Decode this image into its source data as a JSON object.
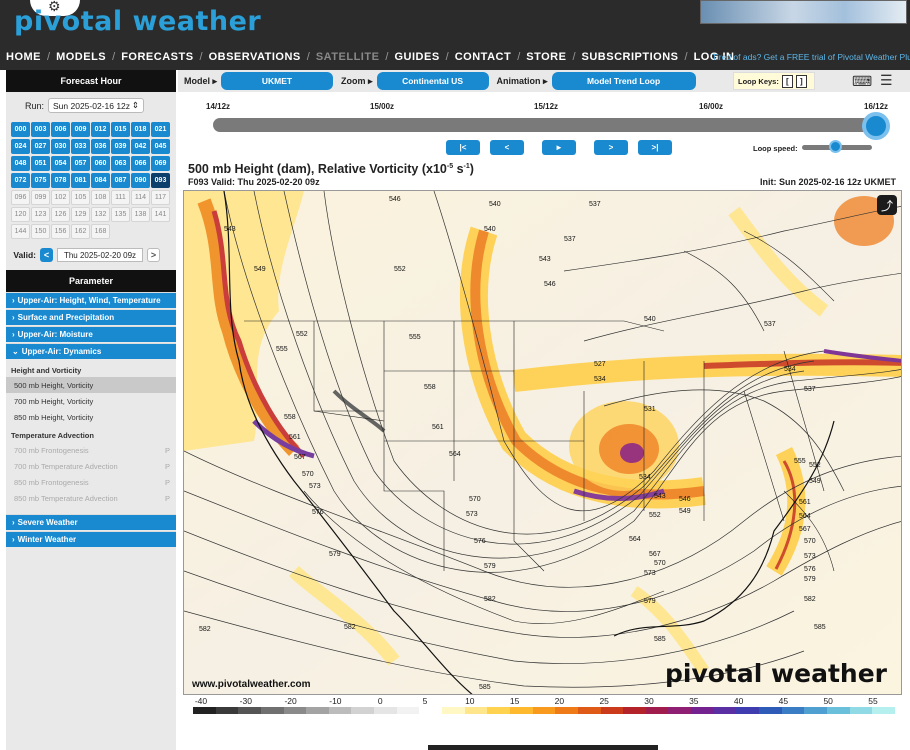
{
  "header": {
    "logo": "pivotal weather",
    "nav": [
      {
        "label": "HOME",
        "dim": false
      },
      {
        "label": "MODELS",
        "dim": false
      },
      {
        "label": "FORECASTS",
        "dim": false
      },
      {
        "label": "OBSERVATIONS",
        "dim": false
      },
      {
        "label": "SATELLITE",
        "dim": true
      },
      {
        "label": "GUIDES",
        "dim": false
      },
      {
        "label": "CONTACT",
        "dim": false
      },
      {
        "label": "STORE",
        "dim": false
      },
      {
        "label": "SUBSCRIPTIONS",
        "dim": false
      },
      {
        "label": "LOG IN",
        "dim": false
      }
    ],
    "promo": "Tired of ads? Get a FREE trial of Pivotal Weather Plus!"
  },
  "sidebar": {
    "forecast_hour_title": "Forecast Hour",
    "run_label": "Run:",
    "run_value": "Sun 2025-02-16 12z",
    "hours": [
      {
        "h": "000",
        "s": "on"
      },
      {
        "h": "003",
        "s": "on"
      },
      {
        "h": "006",
        "s": "on"
      },
      {
        "h": "009",
        "s": "on"
      },
      {
        "h": "012",
        "s": "on"
      },
      {
        "h": "015",
        "s": "on"
      },
      {
        "h": "018",
        "s": "on"
      },
      {
        "h": "021",
        "s": "on"
      },
      {
        "h": "024",
        "s": "on"
      },
      {
        "h": "027",
        "s": "on"
      },
      {
        "h": "030",
        "s": "on"
      },
      {
        "h": "033",
        "s": "on"
      },
      {
        "h": "036",
        "s": "on"
      },
      {
        "h": "039",
        "s": "on"
      },
      {
        "h": "042",
        "s": "on"
      },
      {
        "h": "045",
        "s": "on"
      },
      {
        "h": "048",
        "s": "on"
      },
      {
        "h": "051",
        "s": "on"
      },
      {
        "h": "054",
        "s": "on"
      },
      {
        "h": "057",
        "s": "on"
      },
      {
        "h": "060",
        "s": "on"
      },
      {
        "h": "063",
        "s": "on"
      },
      {
        "h": "066",
        "s": "on"
      },
      {
        "h": "069",
        "s": "on"
      },
      {
        "h": "072",
        "s": "on"
      },
      {
        "h": "075",
        "s": "on"
      },
      {
        "h": "078",
        "s": "on"
      },
      {
        "h": "081",
        "s": "on"
      },
      {
        "h": "084",
        "s": "on"
      },
      {
        "h": "087",
        "s": "on"
      },
      {
        "h": "090",
        "s": "on"
      },
      {
        "h": "093",
        "s": "sel"
      },
      {
        "h": "096",
        "s": "off"
      },
      {
        "h": "099",
        "s": "off"
      },
      {
        "h": "102",
        "s": "off"
      },
      {
        "h": "105",
        "s": "off"
      },
      {
        "h": "108",
        "s": "off"
      },
      {
        "h": "111",
        "s": "off"
      },
      {
        "h": "114",
        "s": "off"
      },
      {
        "h": "117",
        "s": "off"
      },
      {
        "h": "120",
        "s": "off"
      },
      {
        "h": "123",
        "s": "off"
      },
      {
        "h": "126",
        "s": "off"
      },
      {
        "h": "129",
        "s": "off"
      },
      {
        "h": "132",
        "s": "off"
      },
      {
        "h": "135",
        "s": "off"
      },
      {
        "h": "138",
        "s": "off"
      },
      {
        "h": "141",
        "s": "off"
      },
      {
        "h": "144",
        "s": "off"
      },
      {
        "h": "150",
        "s": "off"
      },
      {
        "h": "156",
        "s": "off"
      },
      {
        "h": "162",
        "s": "off"
      },
      {
        "h": "168",
        "s": "off"
      }
    ],
    "valid_label": "Valid:",
    "valid_value": "Thu 2025-02-20 09z",
    "prev": "<",
    "next": ">",
    "parameter_title": "Parameter",
    "categories_top": [
      "Upper-Air: Height, Wind, Temperature",
      "Surface and Precipitation",
      "Upper-Air: Moisture",
      "Upper-Air: Dynamics"
    ],
    "group1": "Height and Vorticity",
    "group1_items": [
      {
        "label": "500 mb Height, Vorticity",
        "state": "sel",
        "p": ""
      },
      {
        "label": "700 mb Height, Vorticity",
        "state": "on",
        "p": ""
      },
      {
        "label": "850 mb Height, Vorticity",
        "state": "on",
        "p": ""
      }
    ],
    "group2": "Temperature Advection",
    "group2_items": [
      {
        "label": "700 mb Frontogenesis",
        "state": "off",
        "p": "P"
      },
      {
        "label": "700 mb Temperature Advection",
        "state": "off",
        "p": "P"
      },
      {
        "label": "850 mb Frontogenesis",
        "state": "off",
        "p": "P"
      },
      {
        "label": "850 mb Temperature Advection",
        "state": "off",
        "p": "P"
      }
    ],
    "categories_bottom": [
      "Severe Weather",
      "Winter Weather"
    ]
  },
  "toolbar": {
    "model_label": "Model ▸",
    "model_value": "UKMET",
    "zoom_label": "Zoom ▸",
    "zoom_value": "Continental US",
    "anim_label": "Animation ▸",
    "anim_value": "Model Trend Loop",
    "loop_keys": "Loop Keys:",
    "key1": "[",
    "key2": "]",
    "kbd_icon": "⌨",
    "settings_icon": "☰"
  },
  "timeline": {
    "ticks": [
      "14/12z",
      "15/00z",
      "15/12z",
      "16/00z",
      "16/12z"
    ],
    "buttons": [
      "|<",
      "<",
      "►",
      ">",
      ">|"
    ],
    "loop_speed": "Loop speed:",
    "title_main": "500 mb Height (dam), Relative Vorticity (x10",
    "title_exp": "-5",
    "title_unit": " s",
    "title_exp2": "-1",
    "title_close": ")",
    "valid": "F093 Valid: Thu 2025-02-20 09z",
    "init": "Init: Sun 2025-02-16 12z UKMET"
  },
  "map": {
    "url": "www.pivotalweather.com",
    "watermark": "pivotal weather",
    "share_icon": "⤴",
    "contour_labels": [
      {
        "t": "543"
      },
      {
        "t": "546"
      },
      {
        "t": "540"
      },
      {
        "t": "537"
      },
      {
        "t": "549"
      },
      {
        "t": "552"
      },
      {
        "t": "540"
      },
      {
        "t": "537"
      },
      {
        "t": "543"
      },
      {
        "t": "546"
      },
      {
        "t": "540"
      },
      {
        "t": "537"
      },
      {
        "t": "555"
      },
      {
        "t": "552"
      },
      {
        "t": "555"
      },
      {
        "t": "534"
      },
      {
        "t": "527"
      },
      {
        "t": "534"
      },
      {
        "t": "558"
      },
      {
        "t": "537"
      },
      {
        "t": "531"
      },
      {
        "t": "558"
      },
      {
        "t": "561"
      },
      {
        "t": "561"
      },
      {
        "t": "564"
      },
      {
        "t": "567"
      },
      {
        "t": "570"
      },
      {
        "t": "534"
      },
      {
        "t": "543"
      },
      {
        "t": "546"
      },
      {
        "t": "549"
      },
      {
        "t": "552"
      },
      {
        "t": "570"
      },
      {
        "t": "573"
      },
      {
        "t": "573"
      },
      {
        "t": "576"
      },
      {
        "t": "576"
      },
      {
        "t": "564"
      },
      {
        "t": "567"
      },
      {
        "t": "570"
      },
      {
        "t": "573"
      },
      {
        "t": "579"
      },
      {
        "t": "579"
      },
      {
        "t": "582"
      },
      {
        "t": "579"
      },
      {
        "t": "582"
      },
      {
        "t": "582"
      },
      {
        "t": "585"
      },
      {
        "t": "585"
      },
      {
        "t": "582"
      },
      {
        "t": "585"
      },
      {
        "t": "555"
      },
      {
        "t": "561"
      },
      {
        "t": "564"
      },
      {
        "t": "567"
      },
      {
        "t": "570"
      },
      {
        "t": "573"
      },
      {
        "t": "576"
      },
      {
        "t": "579"
      },
      {
        "t": "552"
      },
      {
        "t": "549"
      }
    ]
  },
  "colorbar": {
    "labels": [
      "-40",
      "-30",
      "-20",
      "-10",
      "0",
      "5",
      "10",
      "15",
      "20",
      "25",
      "30",
      "35",
      "40",
      "45",
      "50",
      "55"
    ],
    "colors": [
      "#222222",
      "#3a3a3a",
      "#555555",
      "#707070",
      "#8a8a8a",
      "#a3a3a3",
      "#bcbcbc",
      "#d2d2d2",
      "#e5e5e5",
      "#f2f2f2",
      "#ffffff",
      "#fff7c4",
      "#ffe68a",
      "#ffd24f",
      "#ffb92e",
      "#f79a1e",
      "#ee7b18",
      "#e05a17",
      "#cb3a1a",
      "#b4232a",
      "#a01c4d",
      "#8e1f73",
      "#74228f",
      "#5a2fa3",
      "#3f3cb0",
      "#2e5ab8",
      "#3a7dc4",
      "#4f9fd0",
      "#6ac0db",
      "#8fdae5",
      "#b5f0ef"
    ]
  }
}
